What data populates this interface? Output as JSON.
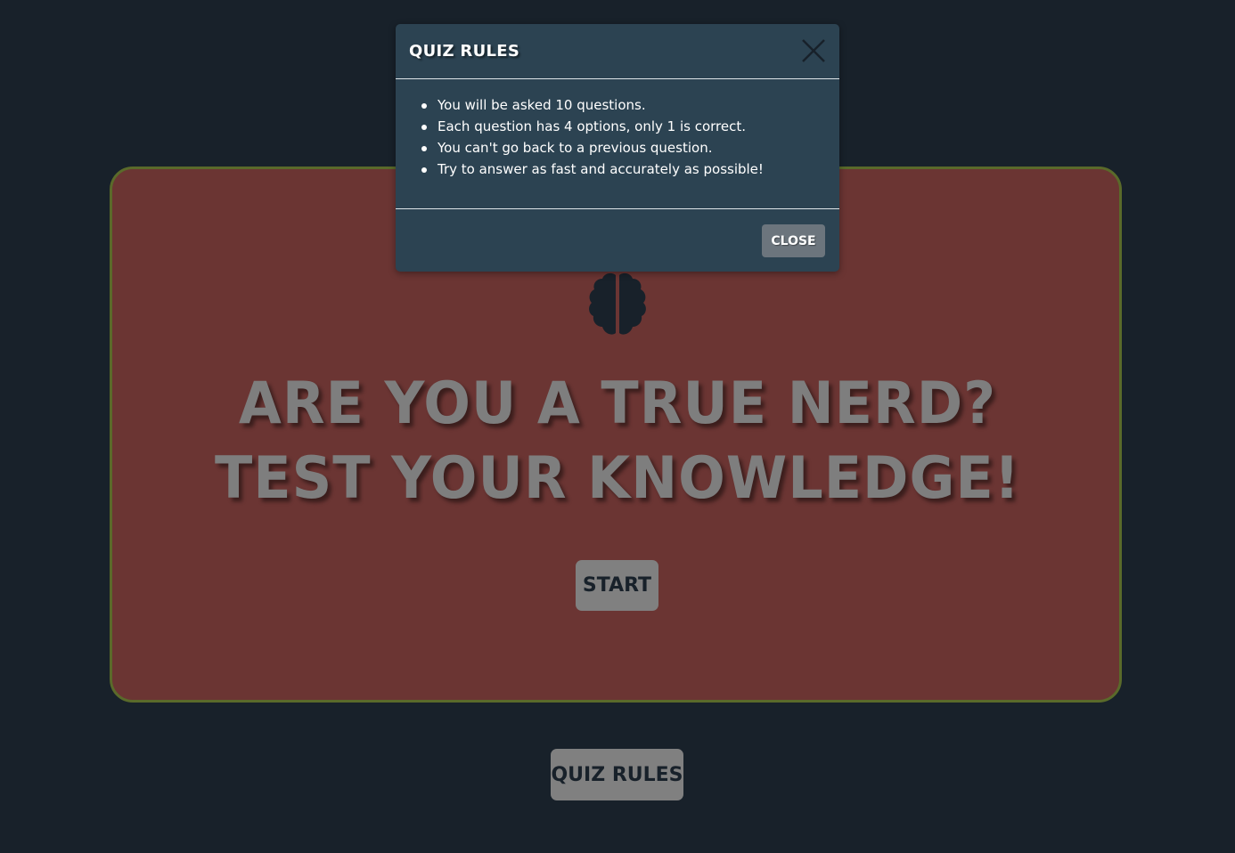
{
  "main": {
    "headline_line1": "ARE YOU A TRUE NERD?",
    "headline_line2": "TEST YOUR KNOWLEDGE!",
    "start_label": "START",
    "icon": "brain-icon"
  },
  "footer": {
    "rules_button_label": "QUIZ RULES"
  },
  "modal": {
    "title": "QUIZ RULES",
    "close_icon": "close-icon",
    "rules": [
      "You will be asked 10 questions.",
      "Each question has 4 options, only 1 is correct.",
      "You can't go back to a previous question.",
      "Try to answer as fast and accurately as possible!"
    ],
    "close_label": "CLOSE"
  },
  "colors": {
    "background": "#18212a",
    "card": "#6b3533",
    "card_border": "#5a6a2a",
    "modal": "#2c4352",
    "button": "#808080",
    "close_button": "#6c757d"
  }
}
